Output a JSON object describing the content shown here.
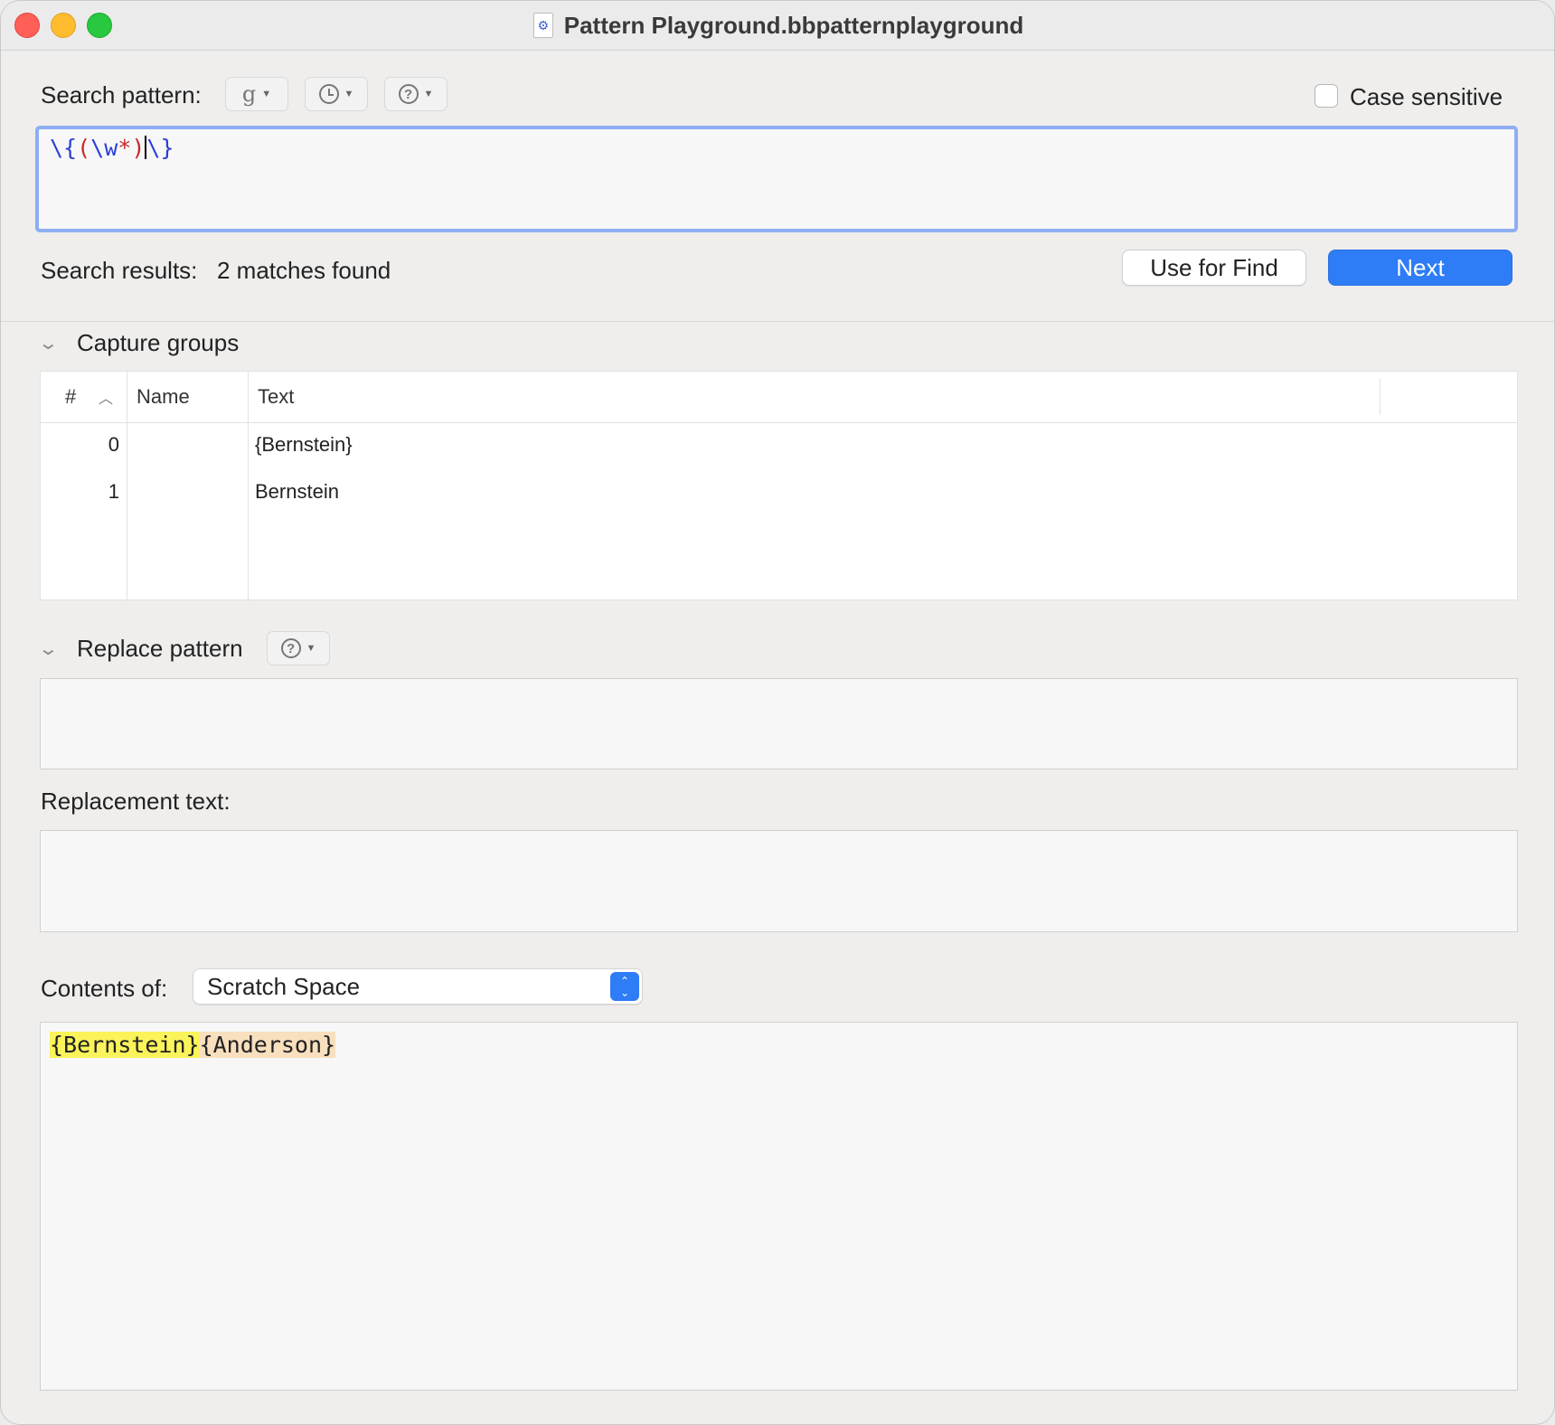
{
  "window": {
    "title": "Pattern Playground.bbpatternplayground",
    "doc_icon": "gear-icon"
  },
  "search": {
    "label": "Search pattern:",
    "grep_button_glyph": "g",
    "case_sensitive_label": "Case sensitive",
    "case_sensitive_checked": false,
    "pattern_tokens": [
      {
        "text": "\\{",
        "color": "#2b3fd6"
      },
      {
        "text": "(",
        "color": "#c82828"
      },
      {
        "text": "\\w",
        "color": "#2b3fd6"
      },
      {
        "text": "*",
        "color": "#c82828"
      },
      {
        "text": ")",
        "color": "#c82828"
      },
      {
        "text": "\\}",
        "color": "#2b3fd6"
      }
    ],
    "results_label": "Search results:",
    "results_value": "2 matches found",
    "use_for_find_label": "Use for Find",
    "next_label": "Next",
    "accent_color": "#2e7cf6"
  },
  "capture_groups": {
    "title": "Capture groups",
    "columns": {
      "num": "#",
      "name": "Name",
      "text": "Text"
    },
    "rows": [
      {
        "num": "0",
        "name": "",
        "text": "{Bernstein}"
      },
      {
        "num": "1",
        "name": "",
        "text": "Bernstein"
      }
    ]
  },
  "replace": {
    "title": "Replace pattern",
    "pattern_value": "",
    "replacement_label": "Replacement text:",
    "replacement_value": ""
  },
  "contents": {
    "label": "Contents of:",
    "selected": "Scratch Space",
    "text_segments": [
      {
        "text": "{Bernstein}",
        "highlight": "#faf35a"
      },
      {
        "text": "{Anderson}",
        "highlight": "#f8dfbd"
      }
    ]
  }
}
